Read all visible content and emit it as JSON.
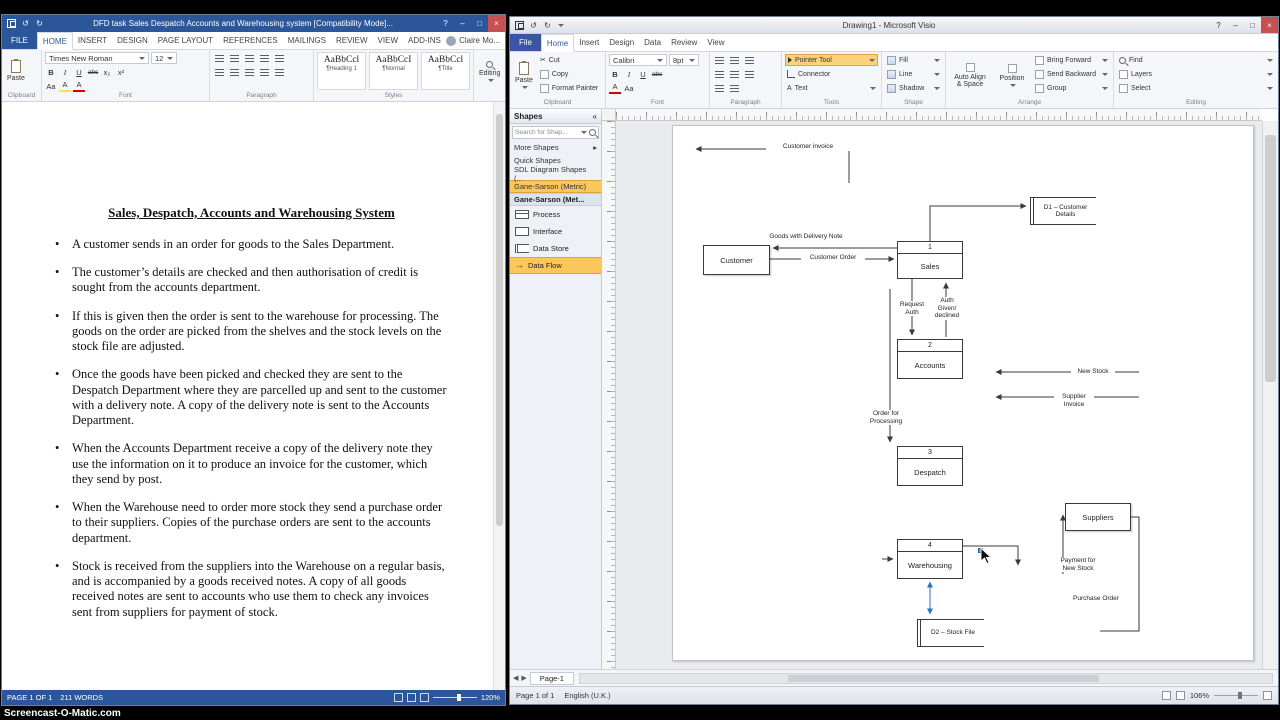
{
  "stage": {
    "watermark": "Screencast-O-Matic.com"
  },
  "icons": {
    "undo": "↺",
    "redo": "↻",
    "minimize": "–",
    "maximize": "□",
    "close": "×",
    "help": "?",
    "collapse": "«",
    "more": "▸",
    "prev": "◀",
    "next": "▶",
    "flow_arrow": "→",
    "bold": "B",
    "italic": "I",
    "underline": "U",
    "strike": "abc",
    "sub": "x₂",
    "sup": "x²",
    "color_a": "A",
    "aa": "Aa",
    "cut_glyph": "✂",
    "text_tool": "A"
  },
  "word": {
    "title": "DFD task Sales Despatch Accounts and Warehousing system [Compatibility Mode]...",
    "tabs": [
      "FILE",
      "HOME",
      "INSERT",
      "DESIGN",
      "PAGE LAYOUT",
      "REFERENCES",
      "MAILINGS",
      "REVIEW",
      "VIEW",
      "ADD-INS"
    ],
    "account": "Claire Mo...",
    "ribbon": {
      "paste": "Paste",
      "clipboard_group": "Clipboard",
      "font_name": "Times New Roman",
      "font_size": "12",
      "font_group": "Font",
      "paragraph_group": "Paragraph",
      "styles": [
        {
          "preview": "AaBbCcl",
          "name": "¶Heading 1"
        },
        {
          "preview": "AaBbCcI",
          "name": "¶Normal"
        },
        {
          "preview": "AaBbCcl",
          "name": "¶Title"
        }
      ],
      "styles_group": "Styles",
      "editing_group": "Editing"
    },
    "doc": {
      "title": "Sales, Despatch, Accounts and Warehousing System",
      "bullets": [
        "A customer sends in an order for goods to the Sales Department.",
        "The customer’s details are checked and then authorisation of credit is sought from the accounts department.",
        "If this is given then the order is sent to the warehouse for processing. The goods on the order are picked from the shelves and the stock levels on the stock file are adjusted.",
        "Once the goods have been picked and checked they are sent to the Despatch Department where they are parcelled up and sent to the customer with a delivery note. A copy of the delivery note is sent to the Accounts Department.",
        "When the Accounts Department receive a copy of the delivery note they use the information on it to produce an invoice for the customer, which they send by post.",
        "When the Warehouse need to order more stock they send a purchase order to their suppliers. Copies of the purchase orders are sent to the accounts department.",
        "Stock is received from the suppliers into the Warehouse on a regular basis, and is accompanied by a goods received notes. A copy of all goods received notes are sent to accounts who use them to check any invoices sent from suppliers for payment of stock."
      ]
    },
    "status": {
      "page": "PAGE 1 OF 1",
      "words": "211 WORDS",
      "zoom": "120%"
    }
  },
  "visio": {
    "title": "Drawing1 - Microsoft Visio",
    "tabs": [
      "File",
      "Home",
      "Insert",
      "Design",
      "Data",
      "Review",
      "View"
    ],
    "ribbon": {
      "paste": "Paste",
      "cut": "Cut",
      "copy": "Copy",
      "format_painter": "Format Painter",
      "clipboard_group": "Clipboard",
      "font_name": "Calibri",
      "font_size": "8pt",
      "font_group": "Font",
      "paragraph_group": "Paragraph",
      "pointer_tool": "Pointer Tool",
      "connector": "Connector",
      "text": "Text",
      "tools_group": "Tools",
      "fill": "Fill",
      "line": "Line",
      "shadow": "Shadow",
      "shape_group": "Shape",
      "auto_align": "Auto Align\n& Space",
      "position": "Position",
      "bring_forward": "Bring Forward",
      "send_backward": "Send Backward",
      "group": "Group",
      "arrange_group": "Arrange",
      "find": "Find",
      "layers": "Layers",
      "select": "Select",
      "editing_group": "Editing"
    },
    "shapes_panel": {
      "header": "Shapes",
      "search": "Search for Shap...",
      "more_shapes": "More Shapes",
      "quick_shapes": "Quick Shapes",
      "sdl": "SDL Diagram Shapes (...",
      "gane_metric": "Gane-Sarson (Metric)",
      "stencil_header": "Gane-Sarson (Met...",
      "stencil_items": [
        "Process",
        "Interface",
        "Data Store",
        "Data Flow"
      ]
    },
    "diagram": {
      "processes": [
        {
          "num": "1",
          "name": "Sales"
        },
        {
          "num": "2",
          "name": "Accounts"
        },
        {
          "num": "3",
          "name": "Despatch"
        },
        {
          "num": "4",
          "name": "Warehousing"
        }
      ],
      "customer": "Customer",
      "suppliers": "Suppliers",
      "d1": "D1 – Customer\nDetails",
      "d2": "D2 – Stock File",
      "flows": {
        "customer_invoice": "Customer invoice",
        "goods": "Goods with Delivery Note",
        "customer_order": "Customer Order",
        "request_auth": "Request\nAuth",
        "auth_given": "Auth\nGiven/\ndeclined",
        "new_stock": "New Stock",
        "supplier_invoice": "Supplier\nInvoice",
        "order_processing": "Order for\nProcessing",
        "payment": "Payment for\nNew Stock",
        "purchase_order": "Purchase Order"
      }
    },
    "status": {
      "page": "Page 1 of 1",
      "lang": "English (U.K.)",
      "tab": "Page-1",
      "zoom": "106%"
    }
  }
}
